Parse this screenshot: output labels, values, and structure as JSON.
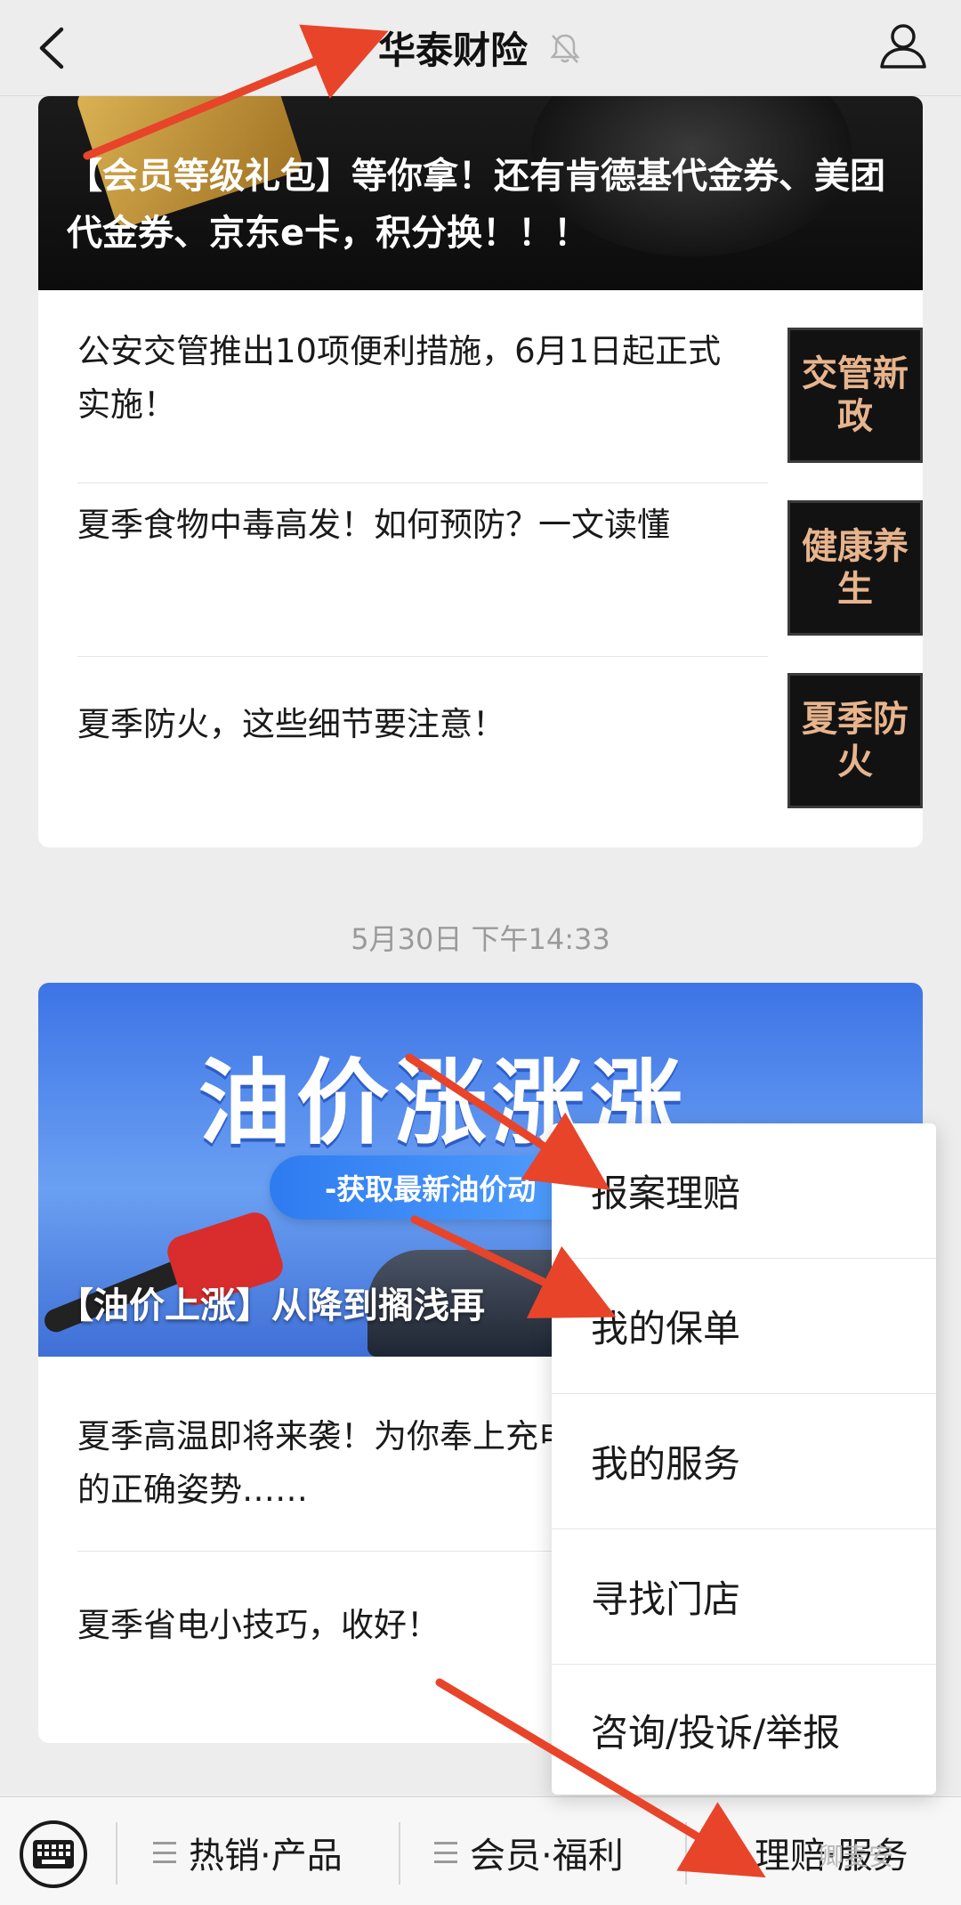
{
  "header": {
    "title": "华泰财险",
    "back_icon": "chevron-left-icon",
    "mute_icon": "bell-muted-icon",
    "profile_icon": "user-icon"
  },
  "card1": {
    "banner_text": "【会员等级礼包】等你拿！还有肯德基代金券、美团代金券、京东e卡，积分换！！！",
    "articles": [
      {
        "title": "公安交管推出10项便利措施，6月1日起正式实施！",
        "thumb": "交管新政"
      },
      {
        "title": "夏季食物中毒高发！如何预防？一文读懂",
        "thumb": "健康养生"
      },
      {
        "title": "夏季防火，这些细节要注意！",
        "thumb": "夏季防火"
      }
    ]
  },
  "timestamp": "5月30日 下午14:33",
  "card2": {
    "banner_big": "油价涨涨涨",
    "banner_pill": "-获取最新油价动",
    "banner_text": "【油价上涨】从降到搁浅再",
    "articles": [
      {
        "title": "夏季高温即将来袭！为你奉上充电的正确姿势……"
      },
      {
        "title": "夏季省电小技巧，收好！"
      }
    ]
  },
  "popup_menu": {
    "items": [
      "报案理赔",
      "我的保单",
      "我的服务",
      "寻找门店",
      "咨询/投诉/举报"
    ]
  },
  "bottom_bar": {
    "keyboard_icon": "keyboard-icon",
    "menus": [
      "热销·产品",
      "会员·福利",
      "理赔·服务"
    ]
  },
  "watermark": "卿麦安",
  "colors": {
    "arrow": "#e8442a",
    "background": "#ededed",
    "thumb_text": "#e7b48d"
  }
}
